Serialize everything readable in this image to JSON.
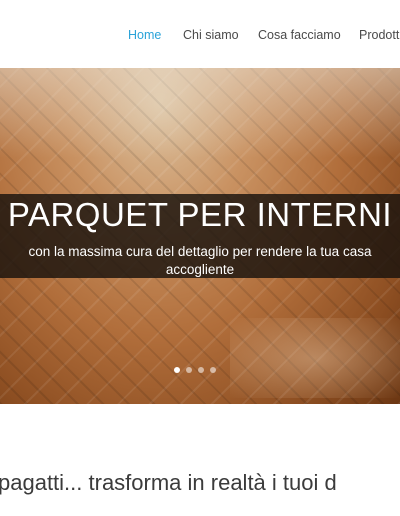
{
  "nav": {
    "items": [
      {
        "label": "Home",
        "active": true
      },
      {
        "label": "Chi siamo",
        "active": false
      },
      {
        "label": "Cosa facciamo",
        "active": false
      },
      {
        "label": "Prodott",
        "active": false
      }
    ],
    "active_color": "#2aa3d8"
  },
  "hero": {
    "title": "PARQUET PER INTERNI",
    "subtitle_line1": "con la massima cura del dettaglio per rendere la tua casa",
    "subtitle_line2": "accogliente",
    "slides_total": 4,
    "active_slide": 1
  },
  "main": {
    "headline": "pagatti... trasforma in realtà i tuoi d"
  }
}
